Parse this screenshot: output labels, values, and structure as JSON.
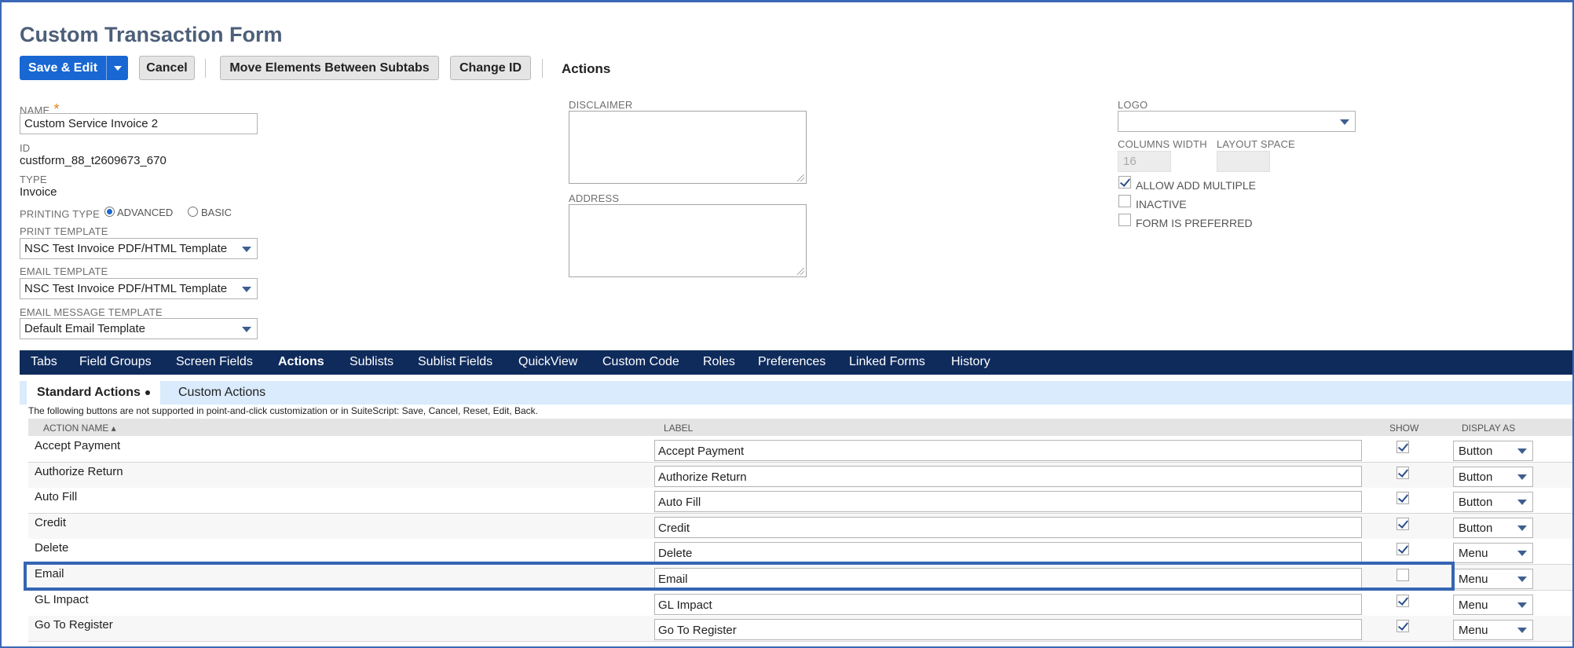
{
  "page": {
    "title": "Custom Transaction Form"
  },
  "toolbar": {
    "save_edit": "Save & Edit",
    "cancel": "Cancel",
    "move_elements": "Move Elements Between Subtabs",
    "change_id": "Change ID",
    "actions": "Actions"
  },
  "fields": {
    "name_label": "NAME",
    "name_required": "*",
    "name_value": "Custom Service Invoice 2",
    "id_label": "ID",
    "id_value": "custform_88_t2609673_670",
    "type_label": "TYPE",
    "type_value": "Invoice",
    "printing_type_label": "PRINTING TYPE",
    "printing_advanced": "ADVANCED",
    "printing_basic": "BASIC",
    "print_template_label": "PRINT TEMPLATE",
    "print_template_value": "NSC Test Invoice PDF/HTML Template",
    "email_template_label": "EMAIL TEMPLATE",
    "email_template_value": "NSC Test Invoice PDF/HTML Template",
    "email_msg_template_label": "EMAIL MESSAGE TEMPLATE",
    "email_msg_template_value": "Default Email Template",
    "disclaimer_label": "DISCLAIMER",
    "address_label": "ADDRESS",
    "logo_label": "LOGO",
    "columns_width_label": "COLUMNS WIDTH",
    "columns_width_value": "16",
    "layout_space_label": "LAYOUT SPACE",
    "allow_add_multiple": "ALLOW ADD MULTIPLE",
    "inactive": "INACTIVE",
    "form_is_preferred": "FORM IS PREFERRED"
  },
  "tabs": [
    "Tabs",
    "Field Groups",
    "Screen Fields",
    "Actions",
    "Sublists",
    "Sublist Fields",
    "QuickView",
    "Custom Code",
    "Roles",
    "Preferences",
    "Linked Forms",
    "History"
  ],
  "active_tab": "Actions",
  "subtabs": {
    "standard": "Standard Actions",
    "custom": "Custom Actions"
  },
  "note": "The following buttons are not supported in point-and-click customization or in SuiteScript: Save, Cancel, Reset, Edit, Back.",
  "table": {
    "headers": {
      "action_name": "ACTION NAME ▴",
      "label": "LABEL",
      "show": "SHOW",
      "display_as": "DISPLAY AS"
    },
    "rows": [
      {
        "name": "Accept Payment",
        "label": "Accept Payment",
        "show": true,
        "display": "Button"
      },
      {
        "name": "Authorize Return",
        "label": "Authorize Return",
        "show": true,
        "display": "Button"
      },
      {
        "name": "Auto Fill",
        "label": "Auto Fill",
        "show": true,
        "display": "Button"
      },
      {
        "name": "Credit",
        "label": "Credit",
        "show": true,
        "display": "Button"
      },
      {
        "name": "Delete",
        "label": "Delete",
        "show": true,
        "display": "Menu"
      },
      {
        "name": "Email",
        "label": "Email",
        "show": false,
        "display": "Menu"
      },
      {
        "name": "GL Impact",
        "label": "GL Impact",
        "show": true,
        "display": "Menu"
      },
      {
        "name": "Go To Register",
        "label": "Go To Register",
        "show": true,
        "display": "Menu"
      }
    ]
  },
  "colors": {
    "accent": "#1967d2",
    "tabbar": "#0f2b5c",
    "subbar": "#d9ebfc",
    "highlight": "#3565b3"
  }
}
